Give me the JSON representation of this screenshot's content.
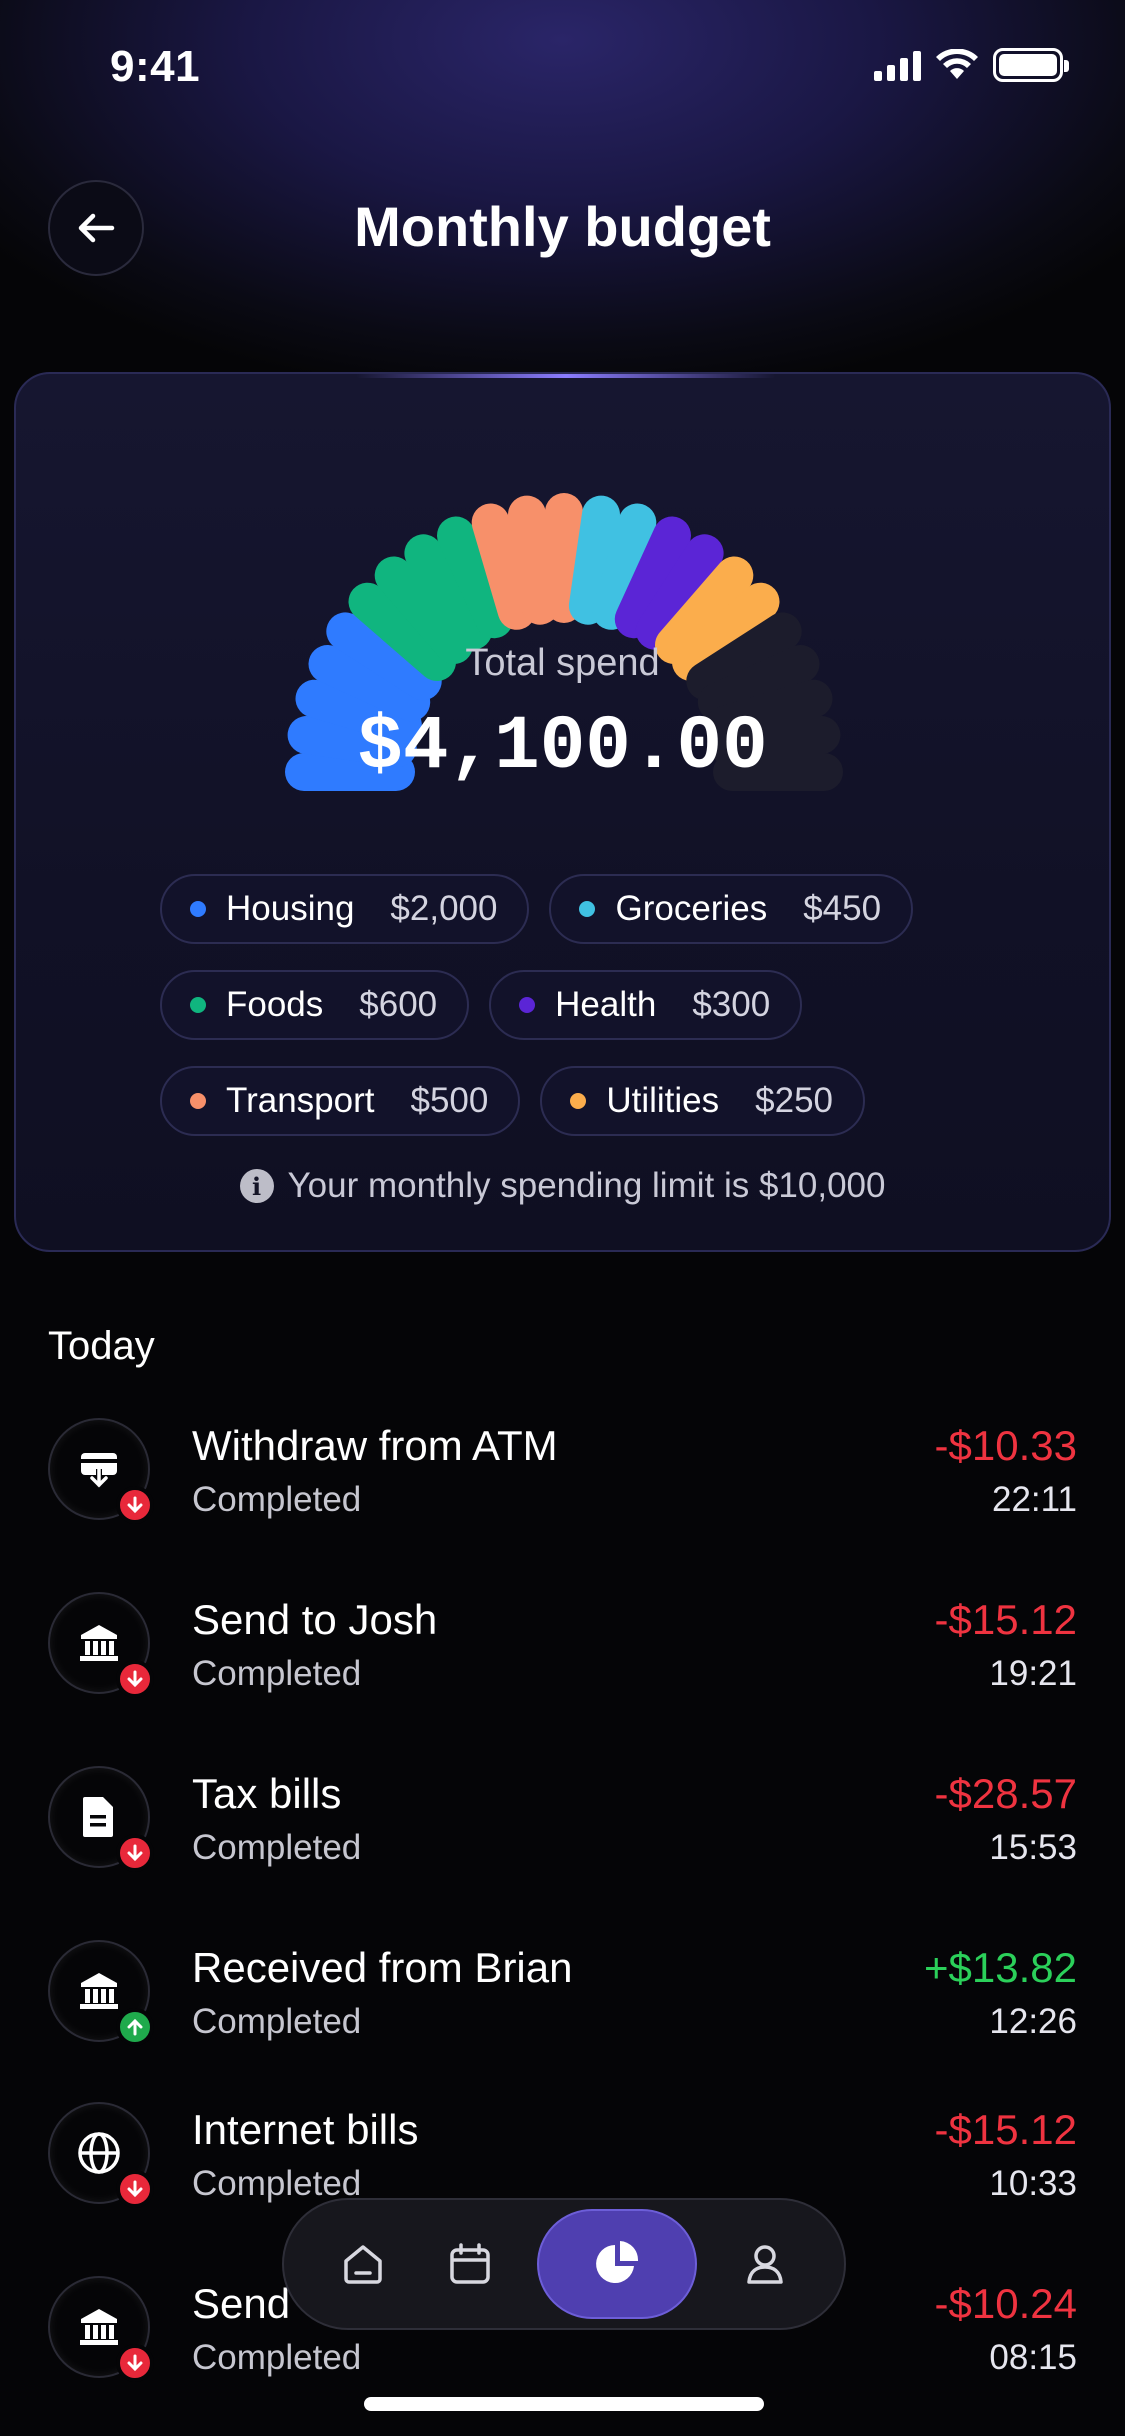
{
  "status_bar": {
    "time": "9:41"
  },
  "header": {
    "title": "Monthly budget"
  },
  "budget": {
    "total_label": "Total spend",
    "total_value": "$4,100.00",
    "limit_note": "Your monthly spending limit is $10,000",
    "colors": {
      "housing": "#2f7bff",
      "foods": "#10b57f",
      "transport": "#f7906a",
      "groceries": "#40c1e2",
      "health": "#5b25d6",
      "utilities": "#fbad4c",
      "empty": "#1c1c2c"
    },
    "categories": [
      {
        "name": "Housing",
        "amount": "$2,000",
        "color": "#2f7bff"
      },
      {
        "name": "Groceries",
        "amount": "$450",
        "color": "#40c1e2"
      },
      {
        "name": "Foods",
        "amount": "$600",
        "color": "#10b57f"
      },
      {
        "name": "Health",
        "amount": "$300",
        "color": "#5b25d6"
      },
      {
        "name": "Transport",
        "amount": "$500",
        "color": "#f7906a"
      },
      {
        "name": "Utilities",
        "amount": "$250",
        "color": "#fbad4c"
      }
    ],
    "gauge_segments": [
      "housing",
      "housing",
      "housing",
      "housing",
      "housing",
      "foods",
      "foods",
      "foods",
      "foods",
      "transport",
      "transport",
      "transport",
      "groceries",
      "groceries",
      "health",
      "health",
      "utilities",
      "utilities",
      "empty",
      "empty",
      "empty",
      "empty",
      "empty"
    ]
  },
  "transactions": {
    "section_title": "Today",
    "items": [
      {
        "name": "Withdraw from ATM",
        "status": "Completed",
        "amount": "-$10.33",
        "time": "22:11",
        "direction": "down",
        "icon": "atm-icon"
      },
      {
        "name": "Send to Josh",
        "status": "Completed",
        "amount": "-$15.12",
        "time": "19:21",
        "direction": "down",
        "icon": "bank-icon"
      },
      {
        "name": "Tax bills",
        "status": "Completed",
        "amount": "-$28.57",
        "time": "15:53",
        "direction": "down",
        "icon": "document-icon"
      },
      {
        "name": "Received from Brian",
        "status": "Completed",
        "amount": "+$13.82",
        "time": "12:26",
        "direction": "up",
        "icon": "bank-icon"
      },
      {
        "name": "Internet bills",
        "status": "Completed",
        "amount": "-$15.12",
        "time": "10:33",
        "direction": "down",
        "icon": "globe-icon"
      },
      {
        "name": "Send",
        "status": "Completed",
        "amount": "-$10.24",
        "time": "08:15",
        "direction": "down",
        "icon": "bank-icon"
      }
    ]
  },
  "nav": {
    "items": [
      "home-icon",
      "calendar-icon",
      "pie-chart-icon",
      "profile-icon"
    ],
    "active": "pie-chart-icon"
  }
}
